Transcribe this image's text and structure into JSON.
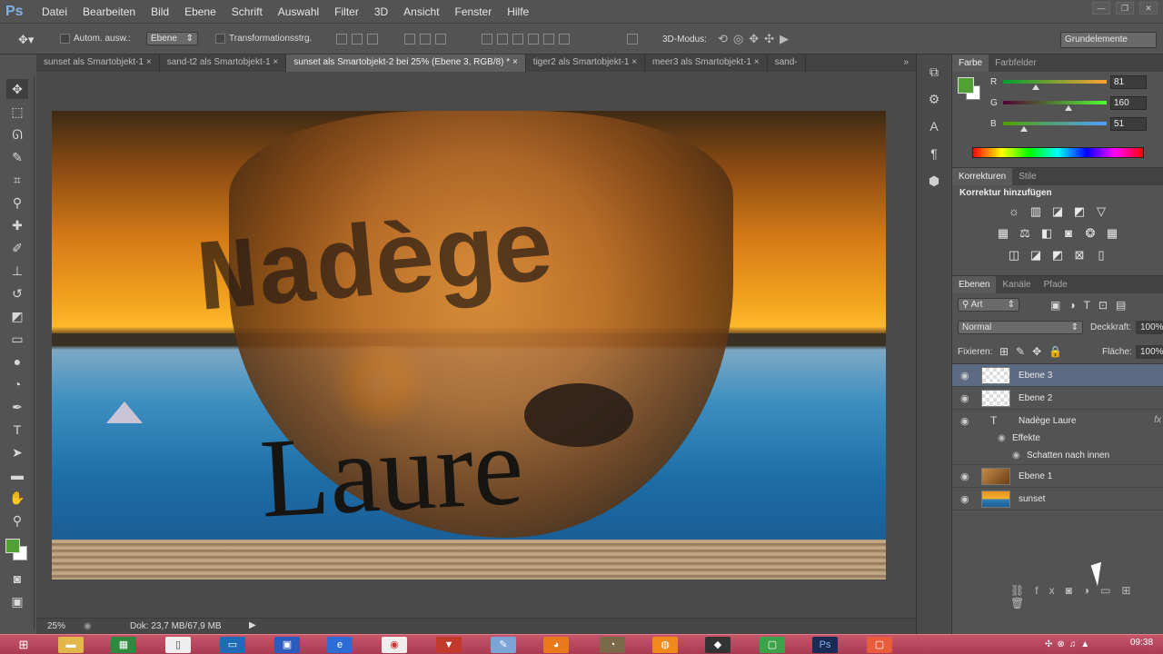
{
  "app": {
    "logo": "Ps"
  },
  "menu": [
    "Datei",
    "Bearbeiten",
    "Bild",
    "Ebene",
    "Schrift",
    "Auswahl",
    "Filter",
    "3D",
    "Ansicht",
    "Fenster",
    "Hilfe"
  ],
  "options": {
    "auto_select_label": "Autom. ausw.:",
    "auto_select_value": "Ebene",
    "transform_label": "Transformationsstrg.",
    "mode3d_label": "3D-Modus:",
    "workspace": "Grundelemente"
  },
  "tabs": [
    {
      "label": "sunset als Smartobjekt-1"
    },
    {
      "label": "sand-t2 als Smartobjekt-1"
    },
    {
      "label": "sunset als Smartobjekt-2 bei 25% (Ebene 3, RGB/8) *"
    },
    {
      "label": "tiger2 als Smartobjekt-1"
    },
    {
      "label": "meer3 als Smartobjekt-1"
    },
    {
      "label": "sand-"
    }
  ],
  "tabs_overflow": "»",
  "canvas": {
    "text_top": "Nadège",
    "text_bottom": "Laure"
  },
  "status": {
    "zoom": "25%",
    "doc": "Dok: 23,7 MB/67,9 MB"
  },
  "color_panel": {
    "tabs": [
      "Farbe",
      "Farbfelder"
    ],
    "r_label": "R",
    "g_label": "G",
    "b_label": "B",
    "r": 81,
    "g": 160,
    "b": 51,
    "foreground": "#51a033"
  },
  "adjust_panel": {
    "tabs": [
      "Korrekturen",
      "Stile"
    ],
    "heading": "Korrektur hinzufügen"
  },
  "layers_panel": {
    "tabs": [
      "Ebenen",
      "Kanäle",
      "Pfade"
    ],
    "filter": "Art",
    "blend_mode": "Normal",
    "opacity_label": "Deckkraft:",
    "opacity": "100%",
    "lock_label": "Fixieren:",
    "fill_label": "Fläche:",
    "fill": "100%",
    "layers": [
      {
        "name": "Ebene 3",
        "selected": true
      },
      {
        "name": "Ebene 2",
        "selected": false
      },
      {
        "name": "Nadège Laure",
        "fx": "fx"
      },
      {
        "name": "Effekte"
      },
      {
        "name": "Schatten nach innen"
      },
      {
        "name": "Ebene 1"
      },
      {
        "name": "sunset"
      }
    ]
  },
  "taskbar": {
    "clock": "09:38"
  }
}
